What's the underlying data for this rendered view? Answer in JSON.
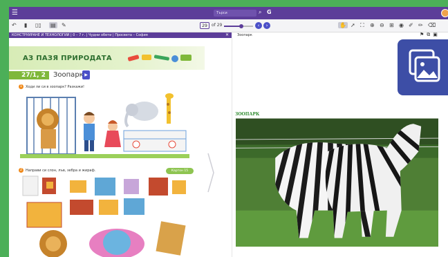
{
  "topbar": {
    "logo": "",
    "search_placeholder": "Търси"
  },
  "toolbar": {
    "page_current": "29",
    "page_total_label": "of 29",
    "zoom_fraction": 0.6
  },
  "breadcrumb": {
    "text": "КОНСТРУИРАНЕ И ТЕХНОЛОГИИ | 0 – 7 г. | Чудни обети | Просвета – София"
  },
  "right_panel": {
    "title": "Зоопарк",
    "photo_label": "ЗООПАРК"
  },
  "lesson": {
    "chapter": "АЗ ПАЗЯ ПРИРОДАТА",
    "tag": "27/1, 2",
    "title": "Зоопарк",
    "badge": "▶",
    "task1_num": "1",
    "task1": "Ходи ли си в зоопарк? Разкажи!",
    "task2_num": "2",
    "task2": "Направи си слон, лъв, зебра и жираф.",
    "ref_pill": "Картон 15"
  },
  "colors": {
    "brand_purple": "#5c3d99",
    "accent_blue": "#4b50c8",
    "green_bg": "#4caf58",
    "chapter_green": "#2d6e2f",
    "lesson_green": "#7fb83a"
  },
  "icons": {
    "menu": "hamburger-icon",
    "search": "search-icon",
    "gallery": "gallery-icon"
  }
}
